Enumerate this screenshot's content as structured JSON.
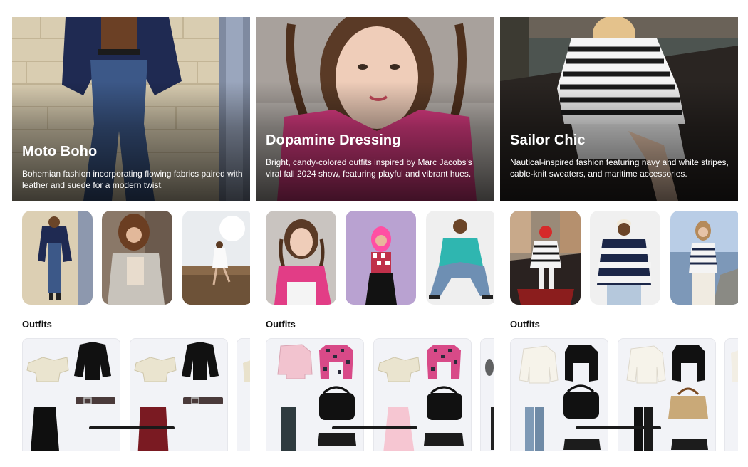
{
  "panels": [
    {
      "title": "Moto Boho",
      "description": "Bohemian fashion incorporating flowing fabrics paired with leather and suede for a modern twist.",
      "looks": [
        "leather-jacket-brick-wall-photo",
        "fringe-jacket-photo",
        "white-dress-field-photo"
      ],
      "outfits_label": "Outfits"
    },
    {
      "title": "Dopamine Dressing",
      "description": "Bright, candy-colored outfits inspired by Marc Jacobs's viral fall 2024 show, featuring playful and vibrant hues.",
      "looks": [
        "pink-top-braids-photo",
        "pink-hair-checkered-photo",
        "teal-sweater-photo"
      ],
      "outfits_label": "Outfits"
    },
    {
      "title": "Sailor Chic",
      "description": "Nautical-inspired fashion featuring navy and white stripes, cable-knit sweaters, and maritime accessories.",
      "looks": [
        "striped-sweater-gondola-photo",
        "striped-rugby-shirt-photo",
        "striped-sweater-seaside-photo"
      ],
      "outfits_label": "Outfits"
    }
  ],
  "colors": {
    "background": "#ffffff",
    "card_bg": "#f2f3f7",
    "text_dark": "#111111",
    "hero_text": "#ffffff"
  }
}
